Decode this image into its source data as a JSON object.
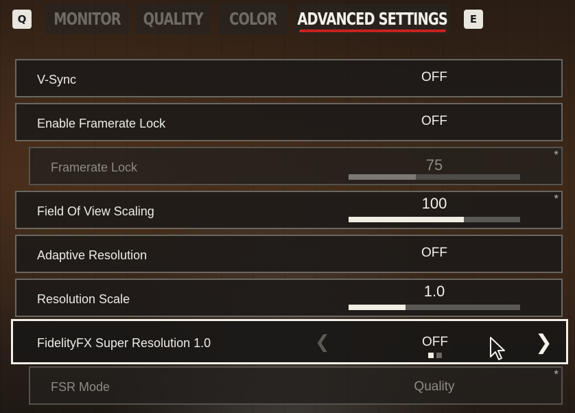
{
  "tabs": {
    "prev_key": "Q",
    "next_key": "E",
    "items": [
      {
        "label": "MONITOR"
      },
      {
        "label": "QUALITY"
      },
      {
        "label": "COLOR"
      },
      {
        "label": "ADVANCED SETTINGS"
      }
    ],
    "active_index": 3
  },
  "settings": {
    "vsync": {
      "label": "V-Sync",
      "value": "OFF"
    },
    "framerate_lock_enable": {
      "label": "Enable Framerate Lock",
      "value": "OFF"
    },
    "framerate_lock": {
      "label": "Framerate Lock",
      "value": "75",
      "slider_fraction": 0.39,
      "disabled": true,
      "star": "*"
    },
    "fov_scaling": {
      "label": "Field Of View Scaling",
      "value": "100",
      "slider_fraction": 0.67,
      "star": "*"
    },
    "adaptive_resolution": {
      "label": "Adaptive Resolution",
      "value": "OFF"
    },
    "resolution_scale": {
      "label": "Resolution Scale",
      "value": "1.0",
      "slider_fraction": 0.33
    },
    "fsr": {
      "label": "FidelityFX Super Resolution 1.0",
      "value": "OFF",
      "selected": true,
      "option_index": 0,
      "option_count": 2
    },
    "fsr_mode": {
      "label": "FSR Mode",
      "value": "Quality",
      "disabled": true,
      "star": "*"
    }
  },
  "colors": {
    "accent_underline": "#c8211f",
    "selected_border": "#f2f0e8"
  }
}
